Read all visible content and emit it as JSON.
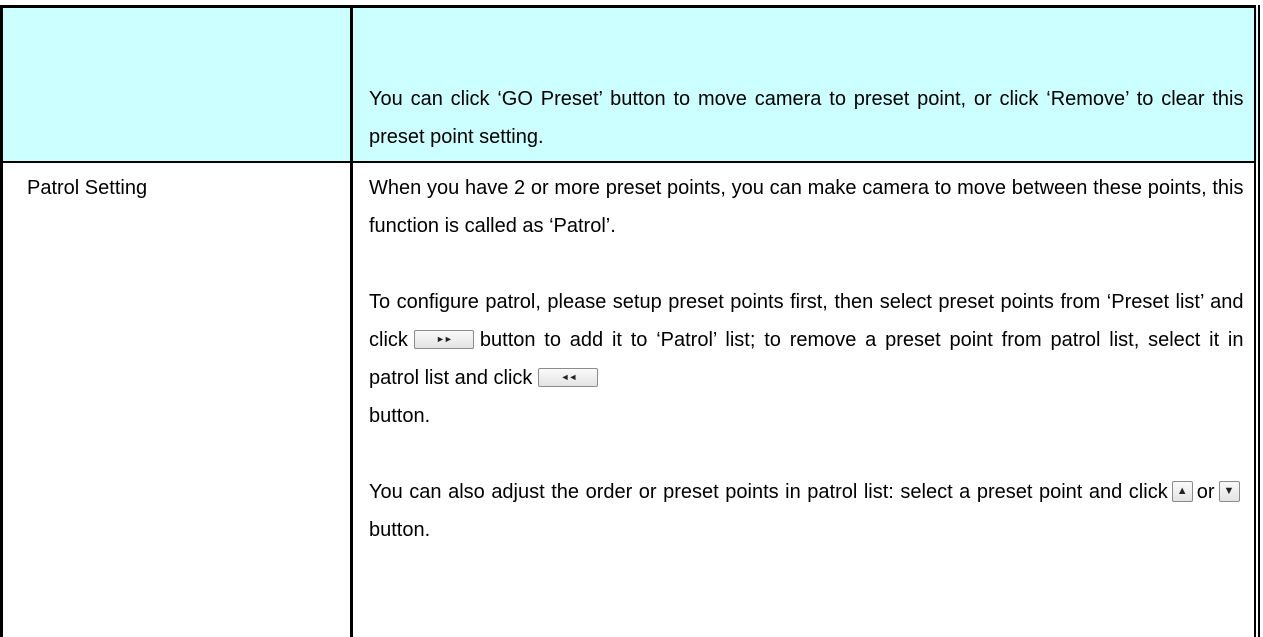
{
  "row1": {
    "right_text": "You can click ‘GO Preset’ button to move camera to preset point, or click ‘Remove’ to clear this preset point setting."
  },
  "row2": {
    "label": "Patrol Setting",
    "para1": "When you have 2 or more preset points, you can make camera to move between these points, this function is called as ‘Patrol’.",
    "para2_a": "To configure patrol, please setup preset points first, then select preset points from ‘Preset list’ and click",
    "para2_b": "button to add it to ‘Patrol’ list; to remove a preset point from patrol list, select it in patrol list and click",
    "para2_c": "button.",
    "para3_a": "You can also adjust the order or preset points in patrol list: select a preset point and click",
    "para3_b": "or",
    "para3_c": "button."
  },
  "icons": {
    "add_button_glyph": "►►",
    "remove_button_glyph": "◄◄",
    "up_button_glyph": "▲",
    "down_button_glyph": "▼"
  },
  "colors": {
    "highlight_row": "#ccffff"
  }
}
